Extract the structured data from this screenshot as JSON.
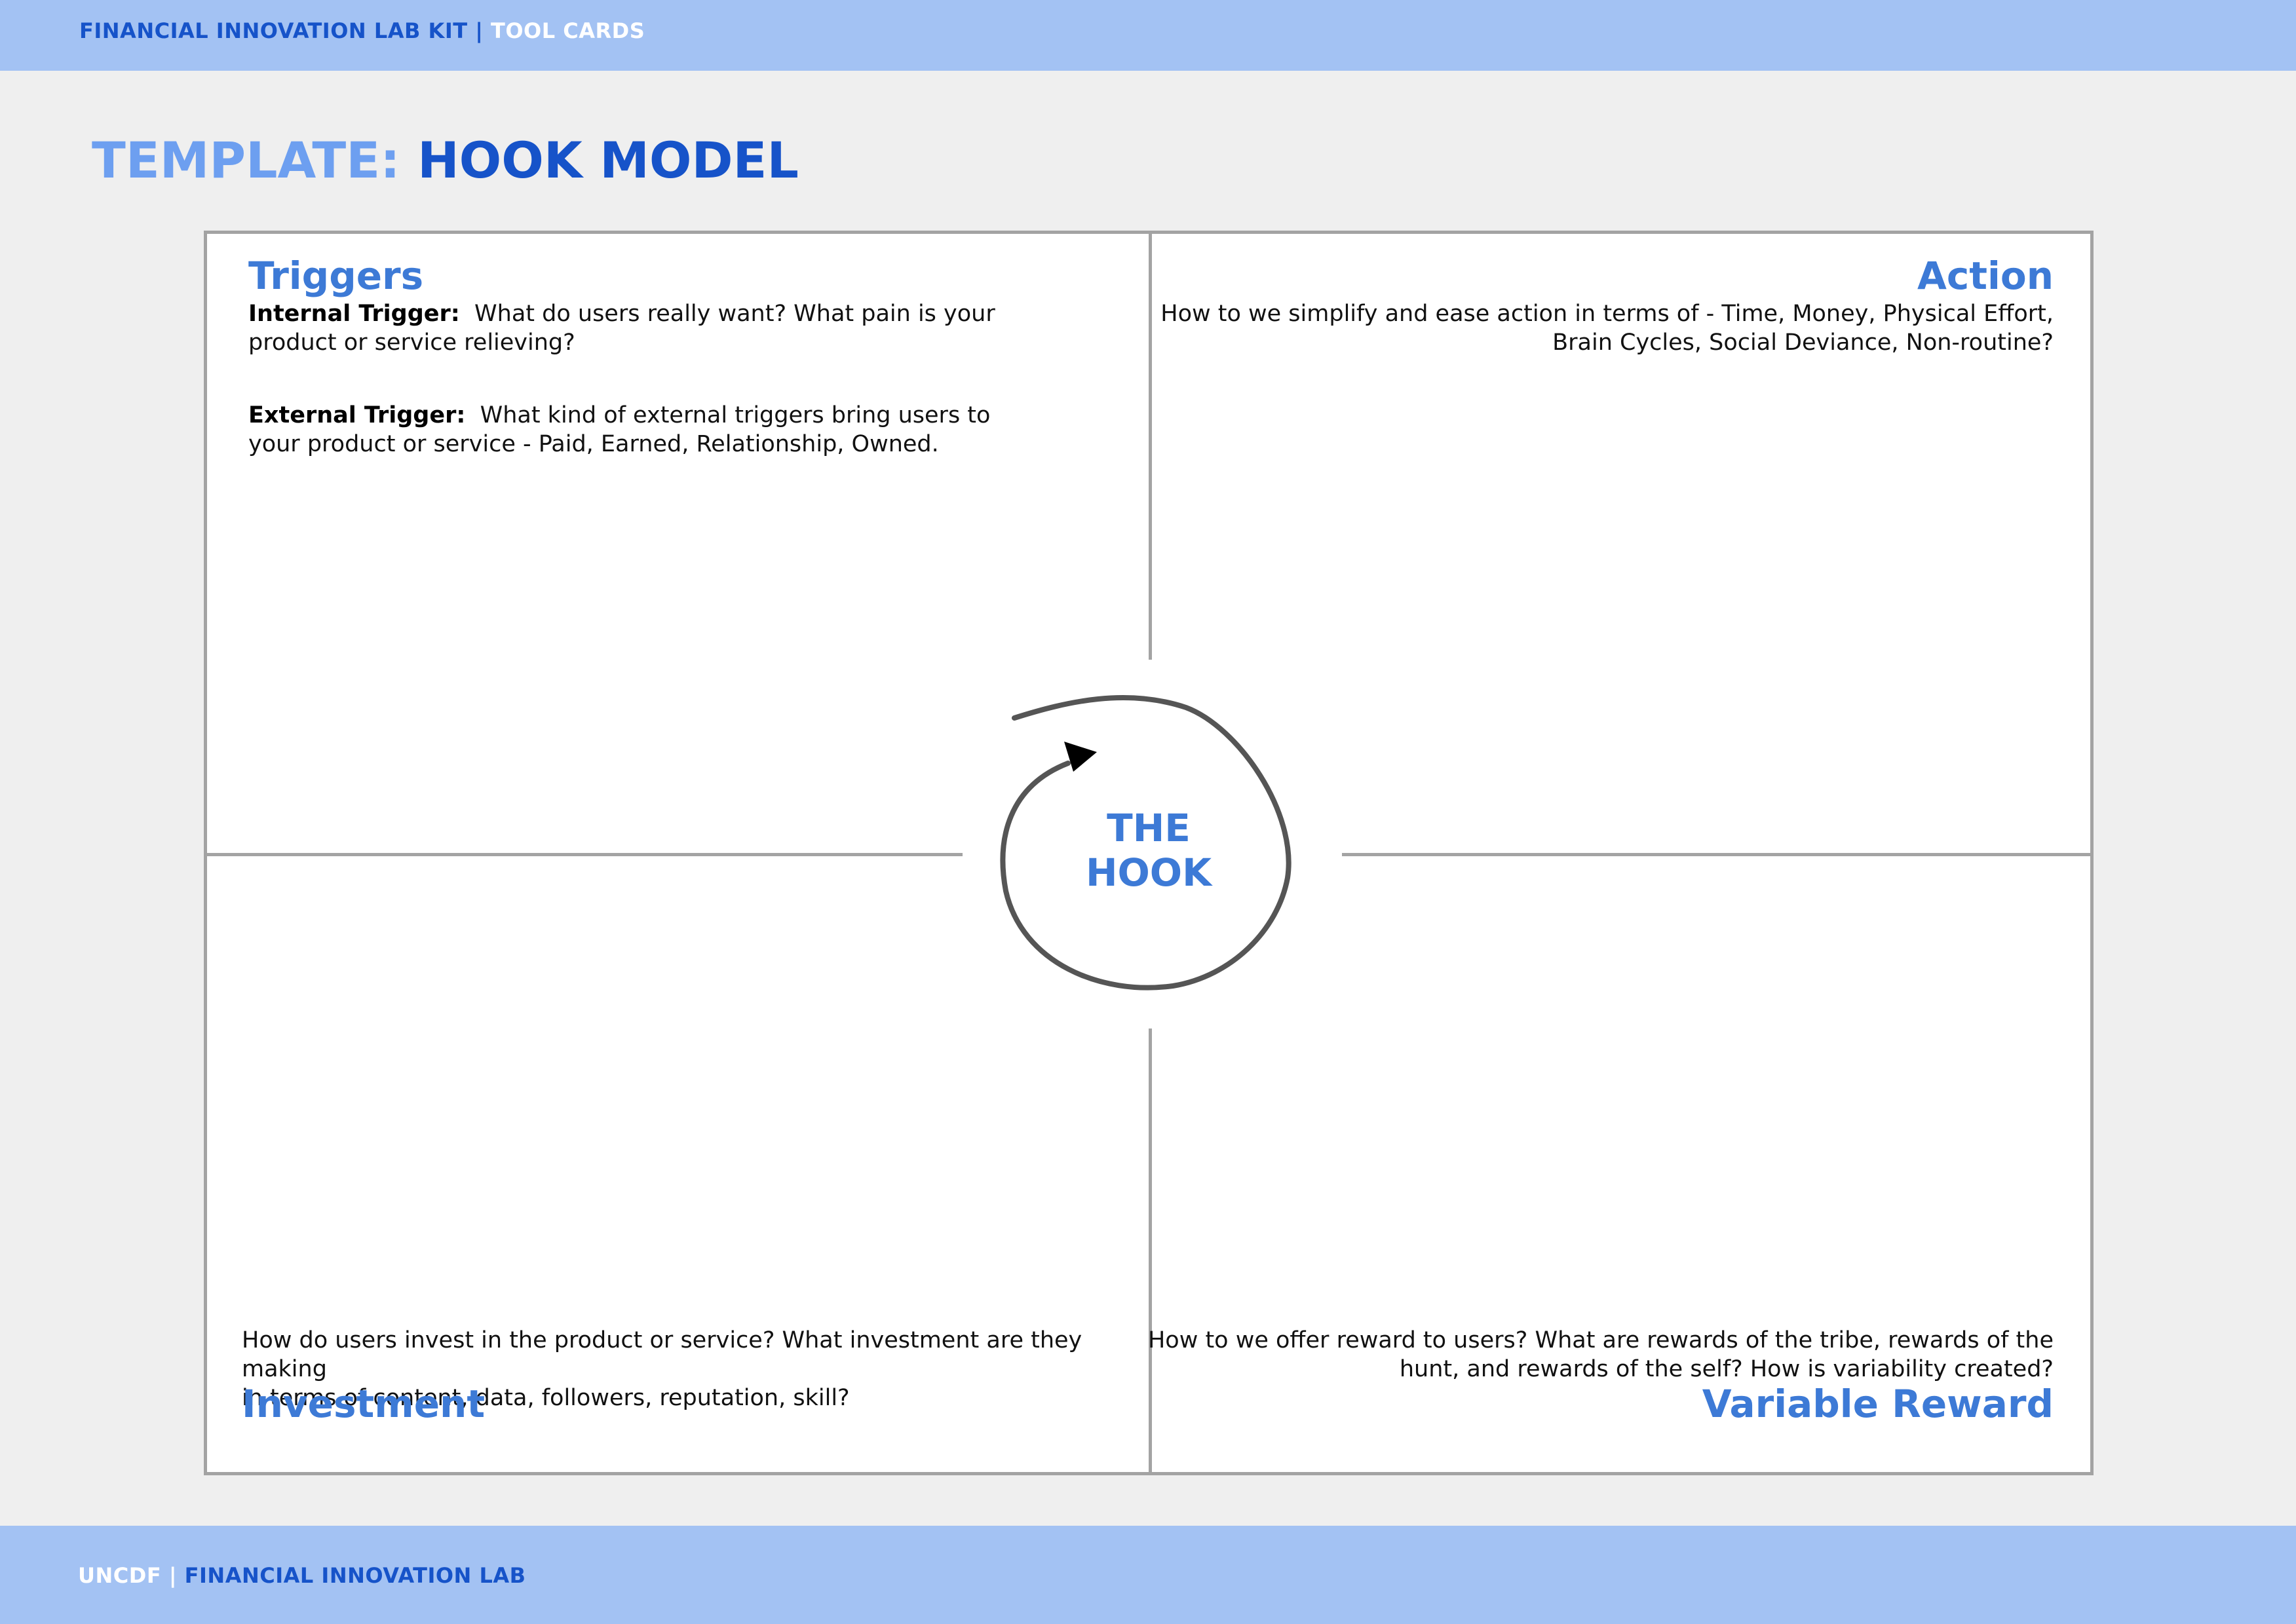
{
  "header": {
    "kit": "FINANCIAL INNOVATION LAB KIT",
    "separator": " | ",
    "section": "TOOL CARDS"
  },
  "title": {
    "prefix": "TEMPLATE:",
    "name": "HOOK MODEL"
  },
  "quadrants": {
    "triggers": {
      "heading": "Triggers",
      "internal_label": "Internal Trigger:",
      "internal_text": "What do users really want? What pain is your product or service relieving?",
      "external_label": "External Trigger:",
      "external_text": "What kind of external triggers bring users to your product or service - Paid, Earned, Relationship, Owned."
    },
    "action": {
      "heading": "Action",
      "line1": "How to we simplify and ease action in terms of - Time, Money, Physical Effort,",
      "line2": "Brain Cycles, Social Deviance, Non-routine?"
    },
    "investment": {
      "heading": "Investment",
      "line1": "How do users invest in the product or service? What investment are they making",
      "line2": "in terms of content, data, followers, reputation, skill?"
    },
    "variable_reward": {
      "heading": "Variable Reward",
      "line1": "How to we offer reward to users? What are rewards of the tribe, rewards of the",
      "line2": "hunt, and rewards of the self? How is variability created?"
    }
  },
  "center": {
    "line1": "THE",
    "line2": "HOOK"
  },
  "footer": {
    "org": "UNCDF",
    "separator": " | ",
    "lab": "FINANCIAL INNOVATION LAB"
  },
  "colors": {
    "band": "#a3c2f3",
    "dark_blue": "#1653c9",
    "heading_blue": "#3d7ad6",
    "title_light_blue": "#6d9ff0",
    "border_gray": "#a3a3a3",
    "background": "#efefef"
  }
}
